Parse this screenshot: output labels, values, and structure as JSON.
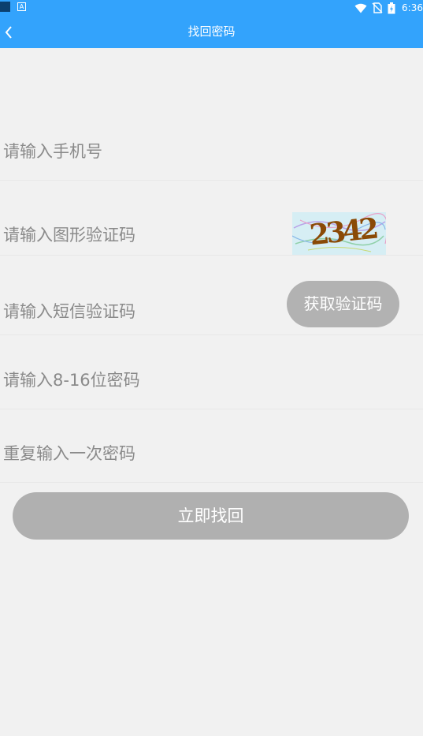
{
  "status_bar": {
    "app_icon_glyph": "A",
    "time": "6:36",
    "icons": [
      "wifi-icon",
      "no-sim-icon",
      "battery-charging-icon"
    ]
  },
  "header": {
    "title": "找回密码",
    "back_icon": "chevron-left-icon"
  },
  "form": {
    "phone": {
      "placeholder": "请输入手机号",
      "value": ""
    },
    "captcha": {
      "placeholder": "请输入图形验证码",
      "value": "",
      "image_text": "2342"
    },
    "sms_code": {
      "placeholder": "请输入短信验证码",
      "value": "",
      "button_label": "获取验证码"
    },
    "password": {
      "placeholder": "请输入8-16位密码",
      "value": ""
    },
    "password_repeat": {
      "placeholder": "重复输入一次密码",
      "value": ""
    }
  },
  "submit": {
    "label": "立即找回"
  },
  "colors": {
    "header_bg": "#33a3fc",
    "page_bg": "#f1f1f1",
    "button_bg": "#b0b0b0",
    "captcha_text": "#8a4a06"
  }
}
